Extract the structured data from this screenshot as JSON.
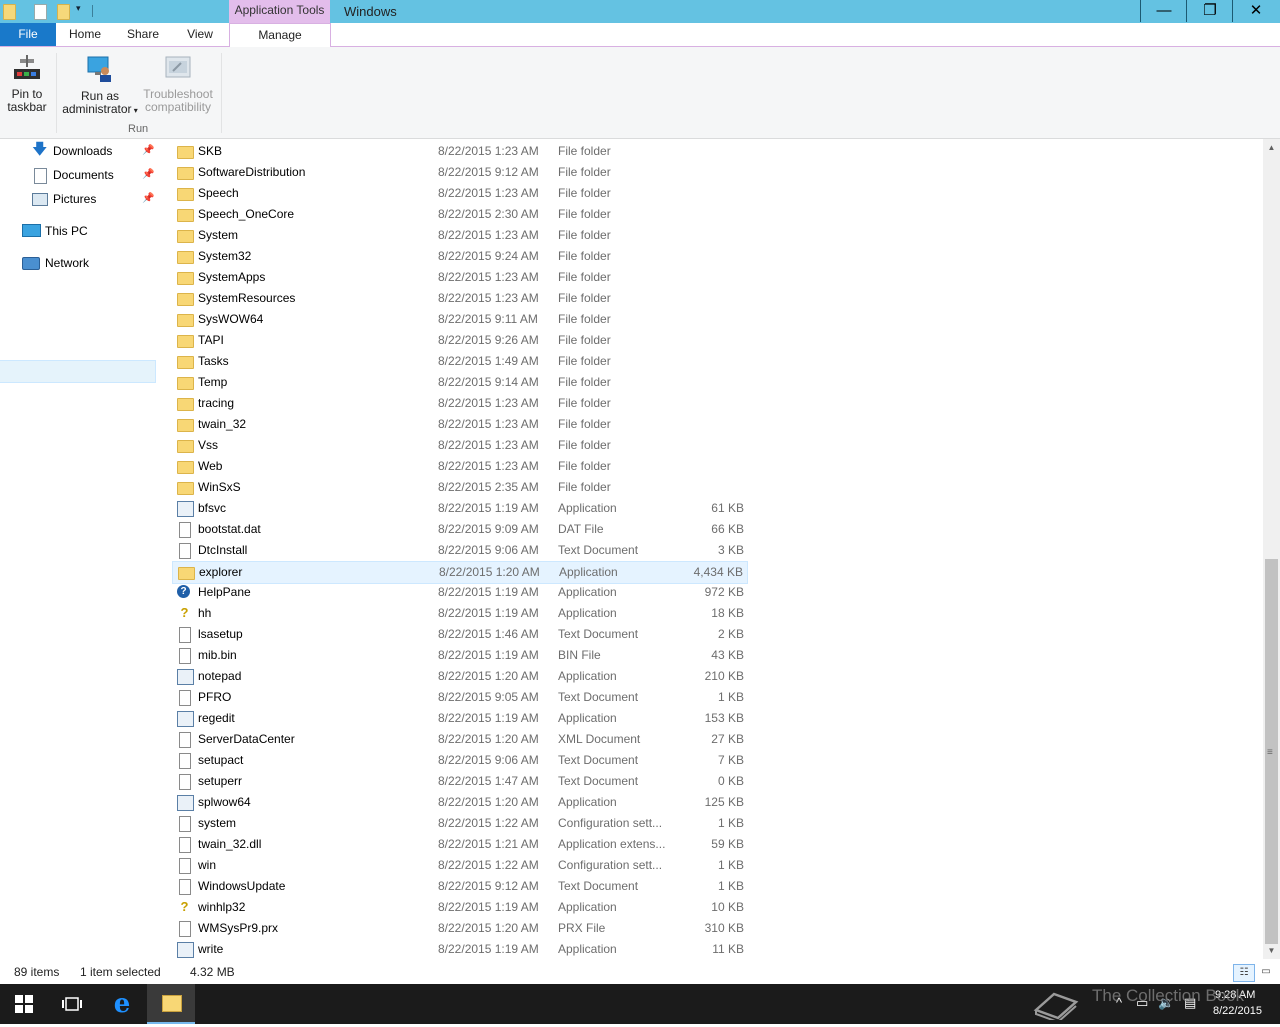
{
  "titlebar": {
    "context_tab": "Application Tools",
    "title": "Windows",
    "minimize": "🗕",
    "restore": "🗗",
    "close": "✕"
  },
  "ribbon_tabs": {
    "file": "File",
    "home": "Home",
    "share": "Share",
    "view": "View",
    "manage": "Manage",
    "help": "?"
  },
  "ribbon": {
    "pin_to_taskbar": [
      "Pin to",
      "taskbar"
    ],
    "run_as_admin": [
      "Run as",
      "administrator"
    ],
    "troubleshoot": [
      "Troubleshoot",
      "compatibility"
    ],
    "group_label": "Run"
  },
  "nav": {
    "downloads": "Downloads",
    "documents": "Documents",
    "pictures": "Pictures",
    "this_pc": "This PC",
    "network": "Network"
  },
  "files": [
    {
      "name": "SKB",
      "date": "8/22/2015 1:23 AM",
      "type": "File folder",
      "size": "",
      "icon": "folder"
    },
    {
      "name": "SoftwareDistribution",
      "date": "8/22/2015 9:12 AM",
      "type": "File folder",
      "size": "",
      "icon": "folder"
    },
    {
      "name": "Speech",
      "date": "8/22/2015 1:23 AM",
      "type": "File folder",
      "size": "",
      "icon": "folder"
    },
    {
      "name": "Speech_OneCore",
      "date": "8/22/2015 2:30 AM",
      "type": "File folder",
      "size": "",
      "icon": "folder"
    },
    {
      "name": "System",
      "date": "8/22/2015 1:23 AM",
      "type": "File folder",
      "size": "",
      "icon": "folder"
    },
    {
      "name": "System32",
      "date": "8/22/2015 9:24 AM",
      "type": "File folder",
      "size": "",
      "icon": "folder"
    },
    {
      "name": "SystemApps",
      "date": "8/22/2015 1:23 AM",
      "type": "File folder",
      "size": "",
      "icon": "folder"
    },
    {
      "name": "SystemResources",
      "date": "8/22/2015 1:23 AM",
      "type": "File folder",
      "size": "",
      "icon": "folder"
    },
    {
      "name": "SysWOW64",
      "date": "8/22/2015 9:11 AM",
      "type": "File folder",
      "size": "",
      "icon": "folder"
    },
    {
      "name": "TAPI",
      "date": "8/22/2015 9:26 AM",
      "type": "File folder",
      "size": "",
      "icon": "folder"
    },
    {
      "name": "Tasks",
      "date": "8/22/2015 1:49 AM",
      "type": "File folder",
      "size": "",
      "icon": "folder"
    },
    {
      "name": "Temp",
      "date": "8/22/2015 9:14 AM",
      "type": "File folder",
      "size": "",
      "icon": "folder"
    },
    {
      "name": "tracing",
      "date": "8/22/2015 1:23 AM",
      "type": "File folder",
      "size": "",
      "icon": "folder"
    },
    {
      "name": "twain_32",
      "date": "8/22/2015 1:23 AM",
      "type": "File folder",
      "size": "",
      "icon": "folder"
    },
    {
      "name": "Vss",
      "date": "8/22/2015 1:23 AM",
      "type": "File folder",
      "size": "",
      "icon": "folder"
    },
    {
      "name": "Web",
      "date": "8/22/2015 1:23 AM",
      "type": "File folder",
      "size": "",
      "icon": "folder"
    },
    {
      "name": "WinSxS",
      "date": "8/22/2015 2:35 AM",
      "type": "File folder",
      "size": "",
      "icon": "folder"
    },
    {
      "name": "bfsvc",
      "date": "8/22/2015 1:19 AM",
      "type": "Application",
      "size": "61 KB",
      "icon": "app"
    },
    {
      "name": "bootstat.dat",
      "date": "8/22/2015 9:09 AM",
      "type": "DAT File",
      "size": "66 KB",
      "icon": "file"
    },
    {
      "name": "DtcInstall",
      "date": "8/22/2015 9:06 AM",
      "type": "Text Document",
      "size": "3 KB",
      "icon": "file"
    },
    {
      "name": "explorer",
      "date": "8/22/2015 1:20 AM",
      "type": "Application",
      "size": "4,434 KB",
      "icon": "folder",
      "selected": true
    },
    {
      "name": "HelpPane",
      "date": "8/22/2015 1:19 AM",
      "type": "Application",
      "size": "972 KB",
      "icon": "help"
    },
    {
      "name": "hh",
      "date": "8/22/2015 1:19 AM",
      "type": "Application",
      "size": "18 KB",
      "icon": "q"
    },
    {
      "name": "lsasetup",
      "date": "8/22/2015 1:46 AM",
      "type": "Text Document",
      "size": "2 KB",
      "icon": "file"
    },
    {
      "name": "mib.bin",
      "date": "8/22/2015 1:19 AM",
      "type": "BIN File",
      "size": "43 KB",
      "icon": "file"
    },
    {
      "name": "notepad",
      "date": "8/22/2015 1:20 AM",
      "type": "Application",
      "size": "210 KB",
      "icon": "app"
    },
    {
      "name": "PFRO",
      "date": "8/22/2015 9:05 AM",
      "type": "Text Document",
      "size": "1 KB",
      "icon": "file"
    },
    {
      "name": "regedit",
      "date": "8/22/2015 1:19 AM",
      "type": "Application",
      "size": "153 KB",
      "icon": "app"
    },
    {
      "name": "ServerDataCenter",
      "date": "8/22/2015 1:20 AM",
      "type": "XML Document",
      "size": "27 KB",
      "icon": "file"
    },
    {
      "name": "setupact",
      "date": "8/22/2015 9:06 AM",
      "type": "Text Document",
      "size": "7 KB",
      "icon": "file"
    },
    {
      "name": "setuperr",
      "date": "8/22/2015 1:47 AM",
      "type": "Text Document",
      "size": "0 KB",
      "icon": "file"
    },
    {
      "name": "splwow64",
      "date": "8/22/2015 1:20 AM",
      "type": "Application",
      "size": "125 KB",
      "icon": "app"
    },
    {
      "name": "system",
      "date": "8/22/2015 1:22 AM",
      "type": "Configuration sett...",
      "size": "1 KB",
      "icon": "file"
    },
    {
      "name": "twain_32.dll",
      "date": "8/22/2015 1:21 AM",
      "type": "Application extens...",
      "size": "59 KB",
      "icon": "file"
    },
    {
      "name": "win",
      "date": "8/22/2015 1:22 AM",
      "type": "Configuration sett...",
      "size": "1 KB",
      "icon": "file"
    },
    {
      "name": "WindowsUpdate",
      "date": "8/22/2015 9:12 AM",
      "type": "Text Document",
      "size": "1 KB",
      "icon": "file"
    },
    {
      "name": "winhlp32",
      "date": "8/22/2015 1:19 AM",
      "type": "Application",
      "size": "10 KB",
      "icon": "q"
    },
    {
      "name": "WMSysPr9.prx",
      "date": "8/22/2015 1:20 AM",
      "type": "PRX File",
      "size": "310 KB",
      "icon": "file"
    },
    {
      "name": "write",
      "date": "8/22/2015 1:19 AM",
      "type": "Application",
      "size": "11 KB",
      "icon": "app"
    }
  ],
  "status": {
    "count": "89 items",
    "selection": "1 item selected",
    "size": "4.32 MB"
  },
  "taskbar": {
    "time": "9:28 AM",
    "date": "8/22/2015",
    "watermark": "The Collection Book"
  },
  "colors": {
    "titlebar": "#64c2e2",
    "context_tab": "#e3bdeb",
    "file_tab": "#1979ca",
    "folder": "#f8d775",
    "taskbar": "#1b1b1b"
  }
}
